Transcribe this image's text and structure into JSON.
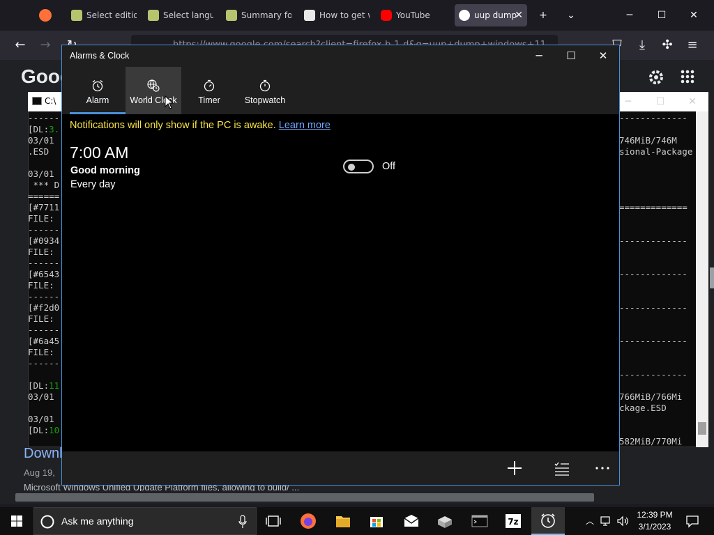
{
  "browser": {
    "tabs": [
      {
        "label": "Select editio",
        "active": false,
        "icon": "uup-dump-icon"
      },
      {
        "label": "Select langu",
        "active": false,
        "icon": "uup-dump-icon"
      },
      {
        "label": "Summary fo",
        "active": false,
        "icon": "uup-dump-icon"
      },
      {
        "label": "How to get w",
        "active": false,
        "icon": "ba-icon"
      },
      {
        "label": "YouTube",
        "active": false,
        "icon": "youtube-icon"
      },
      {
        "label": "uup dump",
        "active": true,
        "icon": "google-icon"
      }
    ],
    "url": "https://www.google.com/search?client=firefox-b-1-d&q=uup+dump+windows+11",
    "page": {
      "logo": "Goog",
      "result_title": "Downl",
      "result_date": "Aug 19,",
      "result_desc": "Microsoft Windows Unified Update Platform files, allowing to build/ ..."
    }
  },
  "console": {
    "title": "C:\\",
    "lines": [
      {
        "text": "------"
      },
      {
        "pre": "[DL:",
        "green": "3.",
        "post": ""
      },
      {
        "text": "03/01"
      },
      {
        "text": ".ESD"
      },
      {
        "text": ""
      },
      {
        "text": "03/01"
      },
      {
        "text": " *** D"
      },
      {
        "text": "======"
      },
      {
        "text": "[#7711"
      },
      {
        "text": "FILE:"
      },
      {
        "text": "------"
      },
      {
        "text": "[#0934"
      },
      {
        "text": "FILE:"
      },
      {
        "text": "------"
      },
      {
        "text": "[#6543"
      },
      {
        "text": "FILE:"
      },
      {
        "text": "------"
      },
      {
        "text": "[#f2d0"
      },
      {
        "text": "FILE:"
      },
      {
        "text": "------"
      },
      {
        "text": "[#6a45"
      },
      {
        "text": "FILE:"
      },
      {
        "text": "------"
      },
      {
        "text": ""
      },
      {
        "pre": "[DL:",
        "green": "11",
        "post": ""
      },
      {
        "text": "03/01"
      },
      {
        "text": ""
      },
      {
        "text": "03/01"
      },
      {
        "pre": "[DL:",
        "green": "10",
        "post": ""
      }
    ],
    "right_lines": [
      "-------------",
      "",
      "746MiB/746M",
      "sional-Package",
      "",
      "",
      "",
      "",
      "=============",
      "",
      "",
      "-------------",
      "",
      "",
      "-------------",
      "",
      "",
      "-------------",
      "",
      "",
      "-------------",
      "",
      "",
      "-------------",
      "",
      "766MiB/766Mi",
      "ckage.ESD",
      "",
      "",
      "582MiB/770Mi"
    ]
  },
  "alarms_app": {
    "title": "Alarms & Clock",
    "tabs": [
      {
        "label": "Alarm",
        "icon": "alarm-clock-icon"
      },
      {
        "label": "World Clock",
        "icon": "globe-icon"
      },
      {
        "label": "Timer",
        "icon": "timer-icon"
      },
      {
        "label": "Stopwatch",
        "icon": "stopwatch-icon"
      }
    ],
    "selected_tab": "Alarm",
    "hovered_tab": "World Clock",
    "notice": "Notifications will only show if the PC is awake.",
    "learn_more": "Learn more",
    "alarm": {
      "time": "7:00 AM",
      "name": "Good morning",
      "repeat": "Every day",
      "toggle_label": "Off",
      "enabled": false
    },
    "commands": [
      "add-icon",
      "select-alarms-icon",
      "more-icon"
    ]
  },
  "taskbar": {
    "search_placeholder": "Ask me anything",
    "apps": [
      "task-view-icon",
      "firefox-icon",
      "file-explorer-icon",
      "store-icon",
      "mail-icon",
      "app-icon",
      "terminal-icon",
      "7zip-icon",
      "alarms-icon"
    ],
    "time": "12:39 PM",
    "date": "3/1/2023"
  },
  "colors": {
    "accent": "#4a90d9",
    "notice": "#f8e34a",
    "link": "#6fa8ff",
    "console_green": "#13a10e"
  }
}
